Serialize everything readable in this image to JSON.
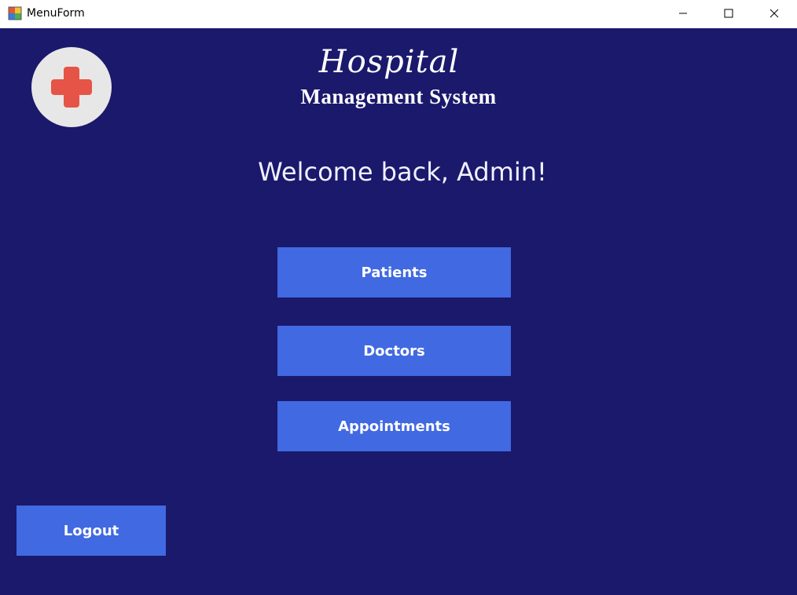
{
  "window": {
    "title": "MenuForm",
    "controls": [
      "minimize",
      "maximize",
      "close"
    ]
  },
  "brand": {
    "logo_icon": "medical-cross-icon",
    "title": "Hospital",
    "subtitle": "Management System"
  },
  "main": {
    "welcome": "Welcome back, Admin!",
    "menu": [
      {
        "label": "Patients"
      },
      {
        "label": "Doctors"
      },
      {
        "label": "Appointments"
      }
    ],
    "logout_label": "Logout"
  },
  "colors": {
    "background": "#1a196c",
    "button": "#4169e1",
    "cross": "#e55447",
    "logo_circle": "#e8e7e7"
  }
}
